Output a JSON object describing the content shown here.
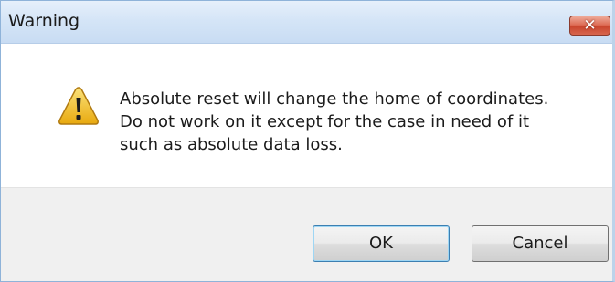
{
  "window": {
    "title": "Warning",
    "close_glyph": "✕"
  },
  "message": {
    "icon": "warning-triangle-icon",
    "lines": [
      "Absolute reset will change the home of coordinates.",
      "Do not work on it except for the case in need of it",
      "such as absolute data loss."
    ]
  },
  "buttons": {
    "ok_label": "OK",
    "cancel_label": "Cancel"
  },
  "colors": {
    "titlebar": "#d5e5f7",
    "close_button": "#d45a41",
    "button_area": "#f0f0f0",
    "warning_icon": "#f2c318"
  }
}
